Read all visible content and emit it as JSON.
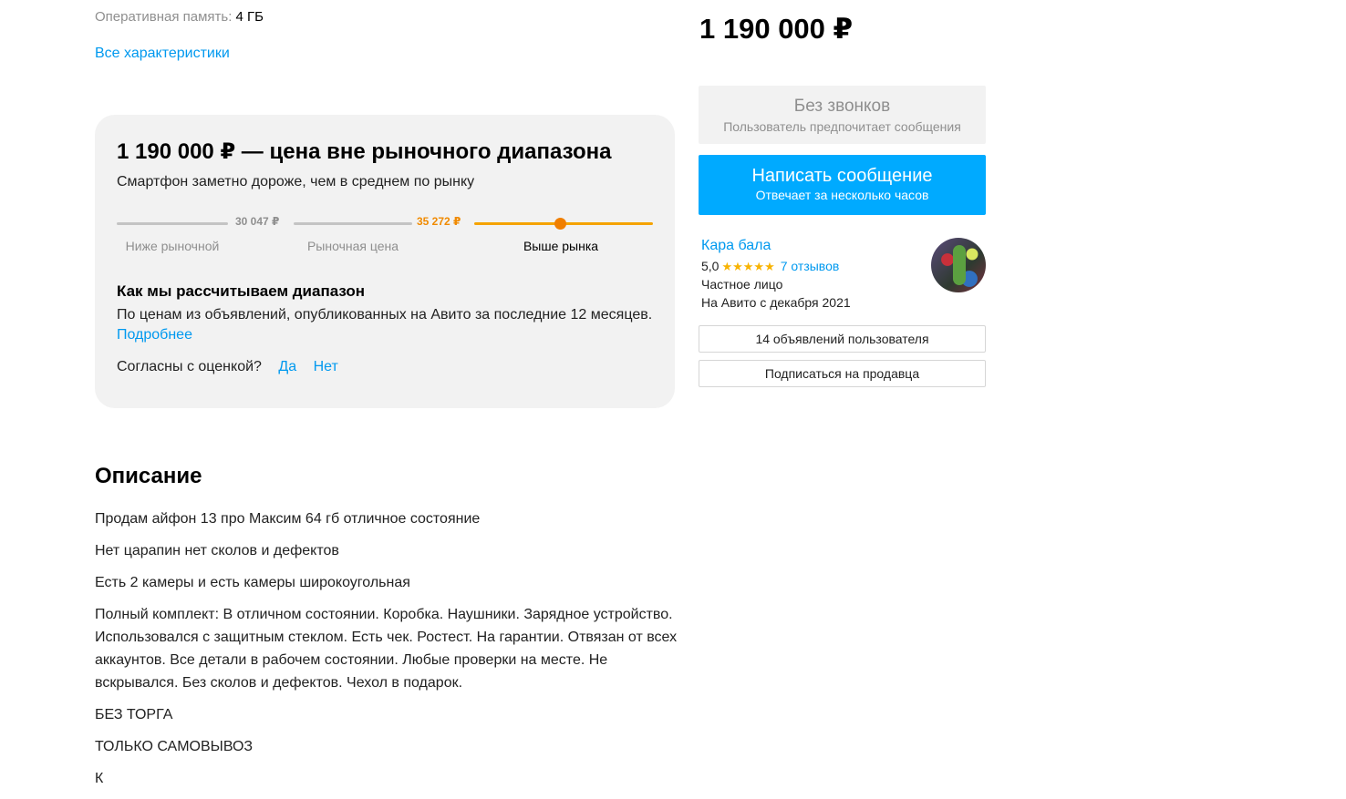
{
  "specs": {
    "ram_label": "Оперативная память:",
    "ram_value": "4 ГБ",
    "all_link": "Все характеристики"
  },
  "price_estimate": {
    "title": "1 190 000 ₽ — цена вне рыночного диапазона",
    "subtitle": "Смартфон заметно дороже, чем в среднем по рынку",
    "tick_low": "30 047 ₽",
    "tick_high": "35 272 ₽",
    "zones": [
      "Ниже рыночной",
      "Рыночная цена",
      "Выше рынка"
    ],
    "how_title": "Как мы рассчитываем диапазон",
    "how_text": "По ценам из объявлений, опубликованных на Авито за последние 12 месяцев.",
    "how_more": "Подробнее",
    "agree_question": "Согласны с оценкой?",
    "agree_yes": "Да",
    "agree_no": "Нет"
  },
  "description": {
    "title": "Описание",
    "paragraphs": [
      "Продам айфон 13 про Максим 64 гб отличное состояние",
      "Нет царапин нет сколов и дефектов",
      "Есть 2 камеры и есть камеры широкоугольная",
      "Полный комплект: В отличном состоянии. Коробка. Наушники. Зарядное устройство. Использовался с защитным стеклом. Есть чек. Ростест. На гарантии. Отвязан от всех аккаунтов. Все детали в рабочем состоянии. Любые проверки на месте. Не вскрывался. Без сколов и дефектов. Чехол в подарок.",
      "БЕЗ ТОРГА",
      "ТОЛЬКО САМОВЫВОЗ",
      "К"
    ]
  },
  "sidebar": {
    "price": "1 190 000 ₽",
    "no_calls_title": "Без звонков",
    "no_calls_sub": "Пользователь предпочитает сообщения",
    "message_button": "Написать сообщение",
    "message_sub": "Отвечает за несколько часов",
    "seller_name": "Кара бала",
    "rating": "5,0",
    "stars": "★★★★★",
    "reviews": "7 отзывов",
    "seller_type": "Частное лицо",
    "seller_since": "На Авито с декабря 2021",
    "listings_button": "14 объявлений пользователя",
    "subscribe_button": "Подписаться на продавца"
  },
  "colors": {
    "accent": "#00aaff",
    "link": "#0099ef",
    "orange": "#f5a300",
    "card_bg": "#f2f2f2"
  }
}
